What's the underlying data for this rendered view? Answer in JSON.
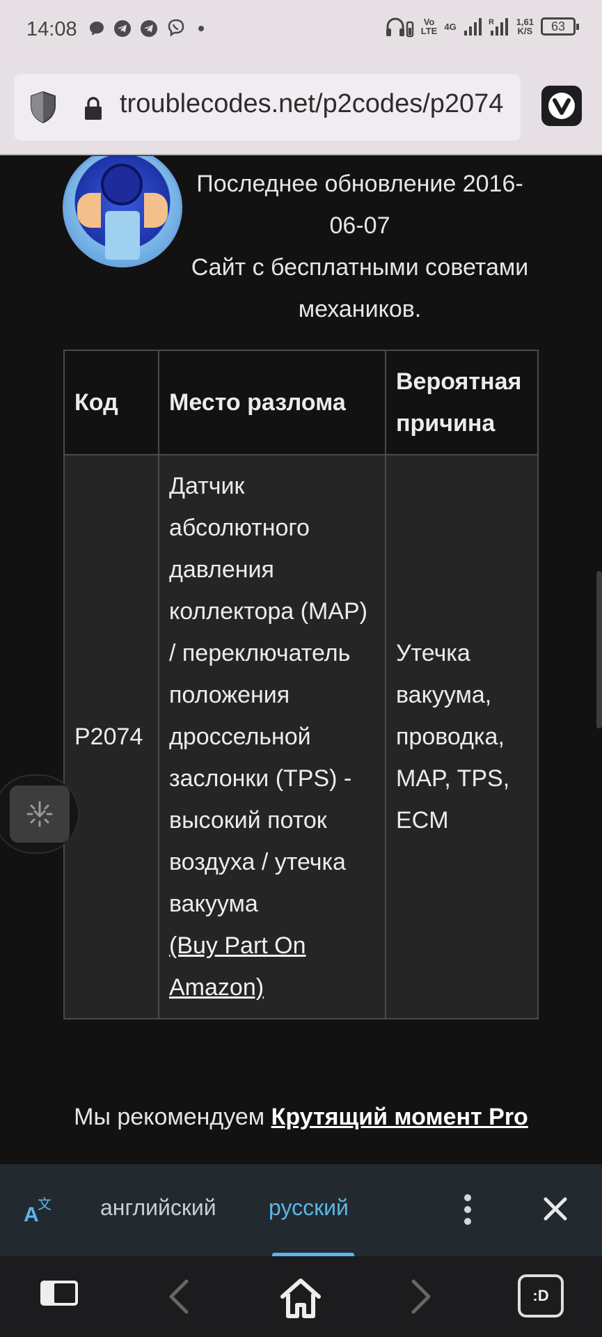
{
  "status_bar": {
    "time": "14:08",
    "net_top": "Vo",
    "net_bottom": "LTE",
    "gen": "4G",
    "speed_top": "1,61",
    "speed_bottom": "K/S",
    "battery": "63"
  },
  "browser": {
    "url": "troublecodes.net/p2codes/p2074"
  },
  "page": {
    "header_lines": [
      "Последнее обновление 2016-06-07",
      "Сайт с бесплатными советами механиков."
    ],
    "table": {
      "headers": [
        "Код",
        "Место разлома",
        "Вероятная причина"
      ],
      "rows": [
        {
          "code": "P2074",
          "location": "Датчик абсолютного давления коллектора (MAP) / переключатель положения дроссельной заслонки (TPS) - высокий поток воздуха / утечка вакуума",
          "link": "(Buy Part On Amazon)",
          "cause": "Утечка вакуума, проводка, MAP, TPS, ECM"
        }
      ]
    },
    "recommend_prefix": "Мы рекомендуем ",
    "recommend_link": "Крутящий момент Pro"
  },
  "translate_bar": {
    "source_lang": "английский",
    "target_lang": "русский",
    "active": "русский"
  },
  "bottom_nav": {
    "tabs_label": ":D"
  },
  "colors": {
    "accent": "#5bb6e8",
    "page_bg": "#121212",
    "cell_bg": "#252525",
    "chrome_bg": "#e6dfe4"
  }
}
